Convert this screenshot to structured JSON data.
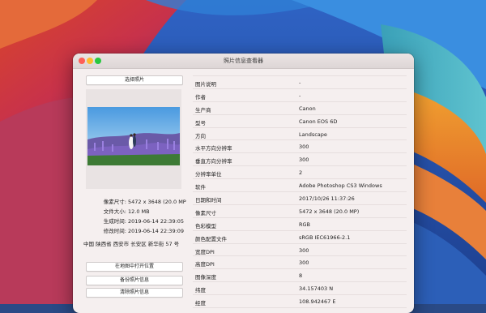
{
  "window": {
    "title": "照片信息查看器"
  },
  "buttons": {
    "select_photo": "选择照片",
    "open_in_map": "在地图中打开位置",
    "backup_info": "备份照片信息",
    "clear_info": "清除照片信息"
  },
  "file_info": [
    {
      "key": "像素尺寸:",
      "value": "5472 x 3648 (20.0 MP"
    },
    {
      "key": "文件大小:",
      "value": "12.0 MB"
    },
    {
      "key": "生成时间:",
      "value": "2019-06-14 22:39:05"
    },
    {
      "key": "修改时间:",
      "value": "2019-06-14 22:39:09"
    }
  ],
  "address": "中国 陕西省 西安市 长安区 新华街 57 号",
  "metadata": [
    {
      "label": "图片说明",
      "value": "-"
    },
    {
      "label": "作者",
      "value": "-"
    },
    {
      "label": "生产商",
      "value": "Canon"
    },
    {
      "label": "型号",
      "value": "Canon EOS 6D"
    },
    {
      "label": "方向",
      "value": "Landscape"
    },
    {
      "label": "水平方向分辨率",
      "value": "300"
    },
    {
      "label": "垂直方向分辨率",
      "value": "300"
    },
    {
      "label": "分辨率单位",
      "value": "2"
    },
    {
      "label": "软件",
      "value": "Adobe Photoshop CS3 Windows"
    },
    {
      "label": "日期和时间",
      "value": "2017/10/26 11:37:26"
    },
    {
      "label": "像素尺寸",
      "value": "5472 x 3648 (20.0 MP)"
    },
    {
      "label": "色彩模型",
      "value": "RGB"
    },
    {
      "label": "颜色配置文件",
      "value": "sRGB IEC61966-2.1"
    },
    {
      "label": "宽度DPI",
      "value": "300"
    },
    {
      "label": "高度DPI",
      "value": "300"
    },
    {
      "label": "图像深度",
      "value": "8"
    },
    {
      "label": "纬度",
      "value": "34.157403 N"
    },
    {
      "label": "经度",
      "value": "108.942467 E"
    }
  ]
}
